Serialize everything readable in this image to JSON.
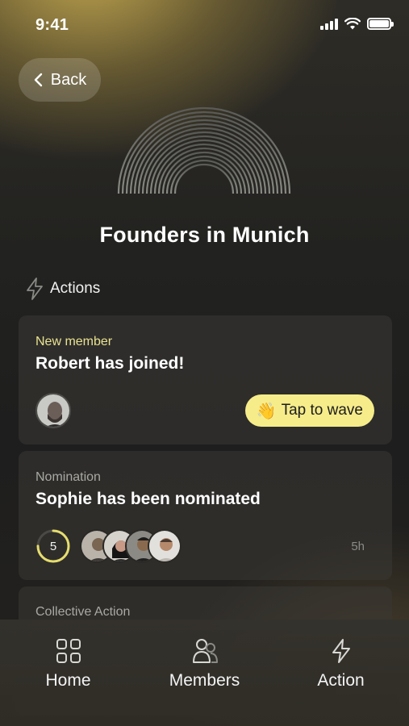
{
  "status_bar": {
    "time": "9:41"
  },
  "nav": {
    "back_label": "Back"
  },
  "group": {
    "title": "Founders in Munich"
  },
  "actions_section": {
    "label": "Actions"
  },
  "cards": [
    {
      "type": "New member",
      "type_color": "#e9e291",
      "title": "Robert has joined!",
      "wave_emoji": "👋",
      "wave_label": "Tap to wave"
    },
    {
      "type": "Nomination",
      "type_color": "#a8a8a4",
      "title": "Sophie has been nominated",
      "count": "5",
      "progress": 0.75,
      "time_ago": "5h"
    },
    {
      "type": "Collective Action",
      "type_color": "#a8a8a4"
    }
  ],
  "tabs": [
    {
      "label": "Home",
      "icon": "grid-icon"
    },
    {
      "label": "Members",
      "icon": "members-icon"
    },
    {
      "label": "Action",
      "icon": "bolt-icon"
    }
  ],
  "colors": {
    "accent": "#f6ec8a",
    "ring": "#e6dd6e"
  }
}
